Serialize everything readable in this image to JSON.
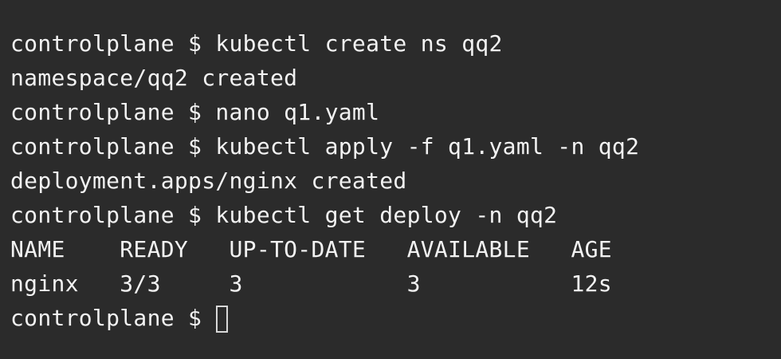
{
  "terminal": {
    "lines": [
      "controlplane $ kubectl create ns qq2",
      "namespace/qq2 created",
      "controlplane $ nano q1.yaml",
      "controlplane $ kubectl apply -f q1.yaml -n qq2",
      "deployment.apps/nginx created",
      "controlplane $ kubectl get deploy -n qq2",
      "NAME    READY   UP-TO-DATE   AVAILABLE   AGE",
      "nginx   3/3     3            3           12s"
    ],
    "prompt": "controlplane $ ",
    "colors": {
      "background": "#2b2b2b",
      "text": "#f2f2f2",
      "cursor": "#d8d8d8"
    }
  }
}
